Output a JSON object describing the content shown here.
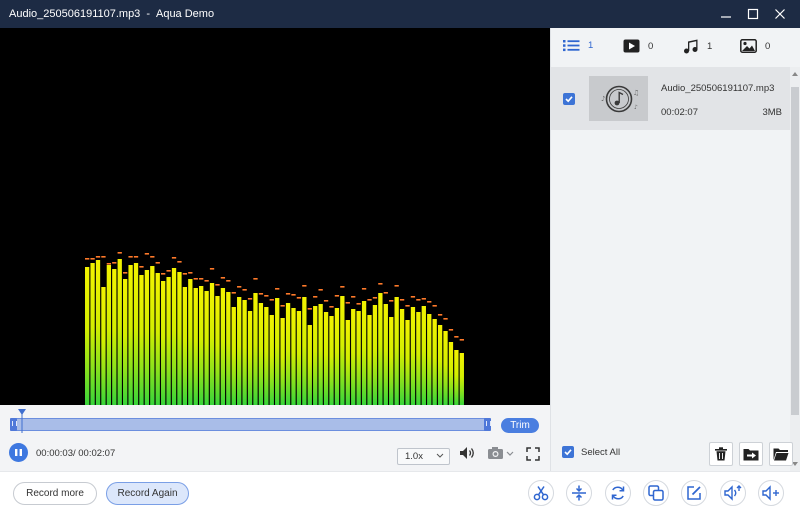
{
  "window": {
    "file_title": "Audio_250506191107.mp3",
    "separator": "-",
    "app_name": "Aqua Demo"
  },
  "player": {
    "time_display": "00:00:03/ 00:02:07",
    "progress_fraction": 0.024,
    "speed": "1.0x",
    "trim_label": "Trim"
  },
  "bottom": {
    "record_more_label": "Record more",
    "record_again_label": "Record Again",
    "tools": [
      "scissors-icon",
      "merge-icon",
      "rotate-icon",
      "copy-icon",
      "edit-icon",
      "volume-boost-icon",
      "add-audio-icon"
    ]
  },
  "sidebar": {
    "filters": [
      {
        "icon": "list-icon",
        "count": "1"
      },
      {
        "icon": "video-icon",
        "count": "0"
      },
      {
        "icon": "music-icon",
        "count": "1"
      },
      {
        "icon": "image-icon",
        "count": "0"
      }
    ],
    "files": [
      {
        "name": "Audio_250506191107.mp3",
        "duration": "00:02:07",
        "size": "3MB",
        "checked": true
      }
    ],
    "select_all_label": "Select All"
  },
  "colors": {
    "titlebar": "#1d2b44",
    "accent": "#3e78e0",
    "bar_top": "#f0f000",
    "bar_bottom": "#3ed83e",
    "peak": "#ff7a2a"
  }
}
